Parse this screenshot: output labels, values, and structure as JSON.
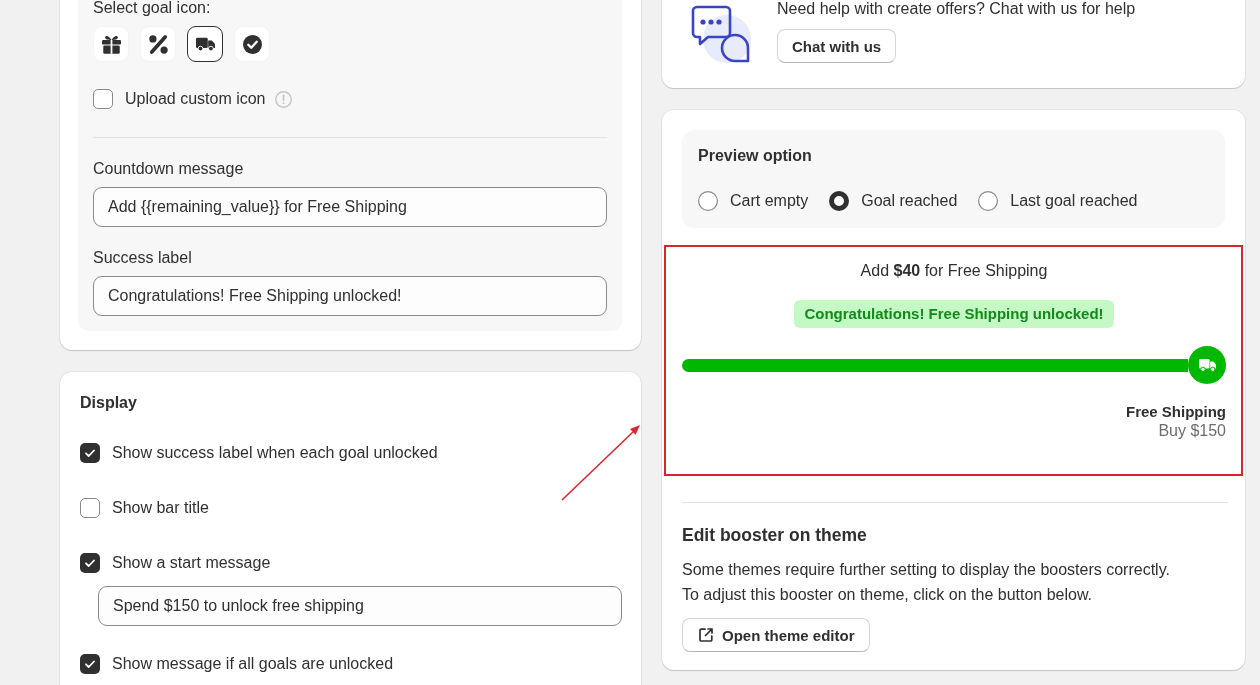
{
  "goal_settings": {
    "icon_label": "Select goal icon:",
    "icons": [
      {
        "kind": "gift",
        "selected": false
      },
      {
        "kind": "percent",
        "selected": false
      },
      {
        "kind": "truck",
        "selected": true
      },
      {
        "kind": "check",
        "selected": false
      }
    ],
    "upload_custom_icon": {
      "label": "Upload custom icon",
      "checked": false
    },
    "fields": [
      {
        "label": "Countdown message",
        "value": "Add {{remaining_value}} for Free Shipping"
      },
      {
        "label": "Success label",
        "value": "Congratulations! Free Shipping unlocked!"
      }
    ]
  },
  "display": {
    "title": "Display",
    "options": [
      {
        "kind": "checkbox",
        "label": "Show success label when each goal unlocked",
        "checked": true
      },
      {
        "kind": "checkbox",
        "label": "Show bar title",
        "checked": false
      },
      {
        "kind": "checkbox",
        "label": "Show a start message",
        "checked": true
      },
      {
        "kind": "input",
        "value": "Spend $150 to unlock free shipping"
      },
      {
        "kind": "checkbox",
        "label": "Show message if all goals are unlocked",
        "checked": true
      }
    ]
  },
  "help": {
    "text": "Need help with create offers? Chat with us for help",
    "button": "Chat with us"
  },
  "preview": {
    "title": "Preview option",
    "options": [
      {
        "label": "Cart empty",
        "selected": false
      },
      {
        "label": "Goal reached",
        "selected": true
      },
      {
        "label": "Last goal reached",
        "selected": false
      }
    ],
    "countdown": "Add **$40** for Free Shipping",
    "success_badge": "Congratulations! Free Shipping unlocked!",
    "progress": {
      "level": 1
    },
    "goal": {
      "title": "Free Shipping",
      "subtitle": "Buy $150"
    }
  },
  "theme_editor": {
    "title": "Edit booster on theme",
    "text": "Some themes require further setting to display the boosters correctly.\nTo adjust this booster on theme, click on the button below.",
    "button": "Open theme editor"
  }
}
